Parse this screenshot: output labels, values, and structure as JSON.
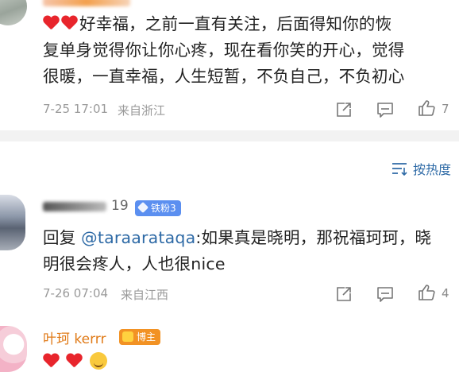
{
  "comments": [
    {
      "avatar": "user-avatar",
      "text_prefix_emoji": [
        "heart",
        "heart"
      ],
      "text_lines": [
        "好幸福，之前一直有关注，后面得知你的恢",
        "复单身觉得你让你心疼，现在看你笑的开心，觉得",
        "很暖，一直幸福，人生短暂，不负自己，不负初心"
      ],
      "time": "7-25 17:01",
      "location": "来自浙江",
      "like_count": "7"
    },
    {
      "name_visible_suffix": "19",
      "badge": "铁粉3",
      "reply_prefix": "回复 ",
      "mention": "@taraarataqa",
      "text_line1_rest": ":如果真是晓明，那祝福珂珂，晓",
      "text_line2": "明很会疼人，人也很nice",
      "time": "7-26 07:04",
      "location": "来自江西",
      "like_count": "4"
    },
    {
      "name": "叶珂 kerrr",
      "badge": "博主",
      "reactions": [
        "heart",
        "heart",
        "smile"
      ]
    }
  ],
  "sort_label": "按热度",
  "colors": {
    "link_blue": "#2e6aa6",
    "host_orange": "#f29224",
    "fan_blue": "#5b8ff0",
    "heart_red": "#e8252c",
    "name_orange": "#e07a17"
  }
}
